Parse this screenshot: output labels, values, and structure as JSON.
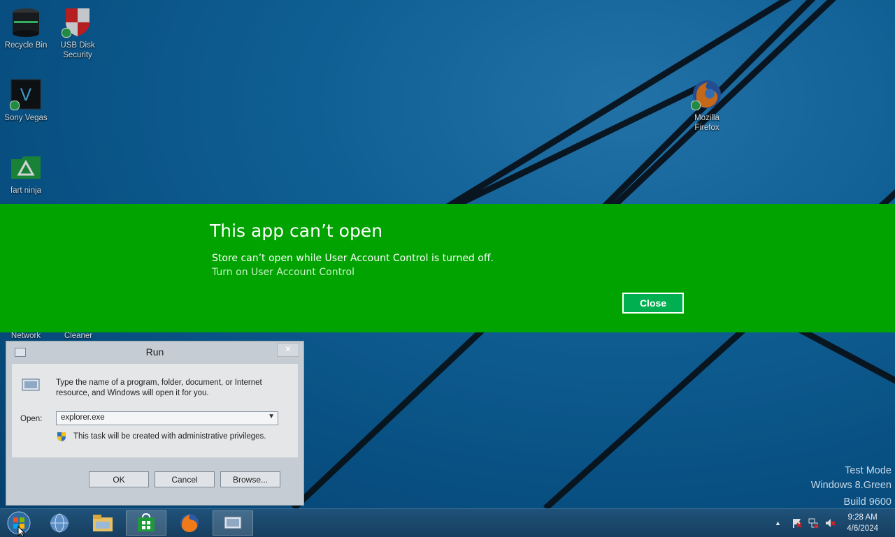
{
  "desktop_icons": {
    "recycle_bin": "Recycle Bin",
    "usb_disk_security_line1": "USB Disk",
    "usb_disk_security_line2": "Security",
    "sony_vegas": "Sony Vegas",
    "fart_ninja": "fart ninja",
    "mozilla_firefox_line1": "Mozilla",
    "mozilla_firefox_line2": "Firefox",
    "network": "Network",
    "cleaner": "Cleaner"
  },
  "banner": {
    "title": "This app can’t open",
    "message": "Store can’t open while User Account Control is turned off.",
    "link": "Turn on User Account Control",
    "close_label": "Close",
    "color": "#00a300"
  },
  "run_dialog": {
    "title": "Run",
    "description": "Type the name of a program, folder, document, or Internet resource, and Windows will open it for you.",
    "open_label": "Open:",
    "open_value": "explorer.exe",
    "admin_note": "This task will be created with administrative privileges.",
    "ok_label": "OK",
    "cancel_label": "Cancel",
    "browse_label": "Browse..."
  },
  "watermark": {
    "line1": "Test Mode",
    "line2": "Windows 8.Green",
    "line3": "Build 9600"
  },
  "taskbar": {
    "items": [
      "start-orb-icon",
      "globe-icon",
      "file-explorer-icon",
      "store-icon",
      "firefox-icon",
      "run-icon"
    ],
    "clock_time": "9:28 AM",
    "clock_date": "4/6/2024"
  }
}
